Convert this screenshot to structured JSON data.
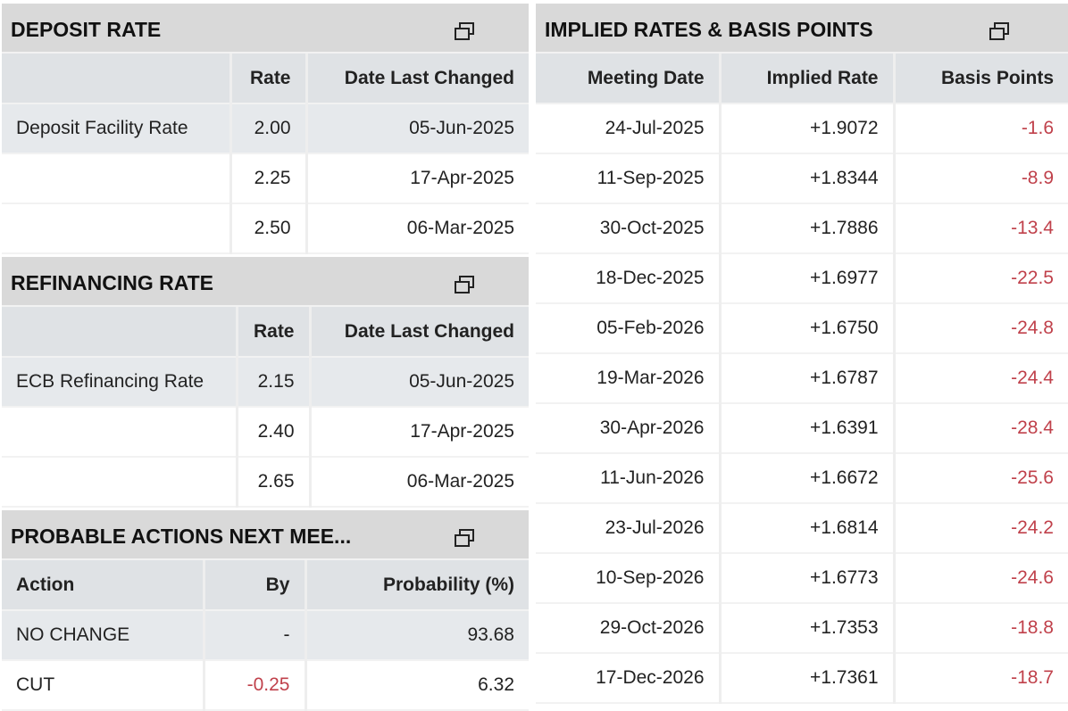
{
  "deposit": {
    "title": "DEPOSIT RATE",
    "headers": [
      "",
      "Rate",
      "Date Last Changed"
    ],
    "rows": [
      [
        "Deposit Facility Rate",
        "2.00",
        "05-Jun-2025"
      ],
      [
        "",
        "2.25",
        "17-Apr-2025"
      ],
      [
        "",
        "2.50",
        "06-Mar-2025"
      ]
    ]
  },
  "refi": {
    "title": "REFINANCING RATE",
    "headers": [
      "",
      "Rate",
      "Date Last Changed"
    ],
    "rows": [
      [
        "ECB Refinancing Rate",
        "2.15",
        "05-Jun-2025"
      ],
      [
        "",
        "2.40",
        "17-Apr-2025"
      ],
      [
        "",
        "2.65",
        "06-Mar-2025"
      ]
    ]
  },
  "probable": {
    "title": "PROBABLE ACTIONS NEXT MEE...",
    "headers": [
      "Action",
      "By",
      "Probability (%)"
    ],
    "rows": [
      [
        "NO CHANGE",
        "-",
        "93.68"
      ],
      [
        "CUT",
        "-0.25",
        "6.32"
      ]
    ]
  },
  "implied": {
    "title": "IMPLIED RATES & BASIS POINTS",
    "headers": [
      "Meeting Date",
      "Implied Rate",
      "Basis Points"
    ],
    "rows": [
      [
        "24-Jul-2025",
        "+1.9072",
        "-1.6"
      ],
      [
        "11-Sep-2025",
        "+1.8344",
        "-8.9"
      ],
      [
        "30-Oct-2025",
        "+1.7886",
        "-13.4"
      ],
      [
        "18-Dec-2025",
        "+1.6977",
        "-22.5"
      ],
      [
        "05-Feb-2026",
        "+1.6750",
        "-24.8"
      ],
      [
        "19-Mar-2026",
        "+1.6787",
        "-24.4"
      ],
      [
        "30-Apr-2026",
        "+1.6391",
        "-28.4"
      ],
      [
        "11-Jun-2026",
        "+1.6672",
        "-25.6"
      ],
      [
        "23-Jul-2026",
        "+1.6814",
        "-24.2"
      ],
      [
        "10-Sep-2026",
        "+1.6773",
        "-24.6"
      ],
      [
        "29-Oct-2026",
        "+1.7353",
        "-18.8"
      ],
      [
        "17-Dec-2026",
        "+1.7361",
        "-18.7"
      ]
    ]
  },
  "colors": {
    "negative": "#c0414b",
    "title_bar": "#d9d9d9",
    "header_row": "#dfe2e5",
    "highlight_row": "#e6e9ec"
  },
  "icons": {
    "popout": "popout-window-icon"
  }
}
